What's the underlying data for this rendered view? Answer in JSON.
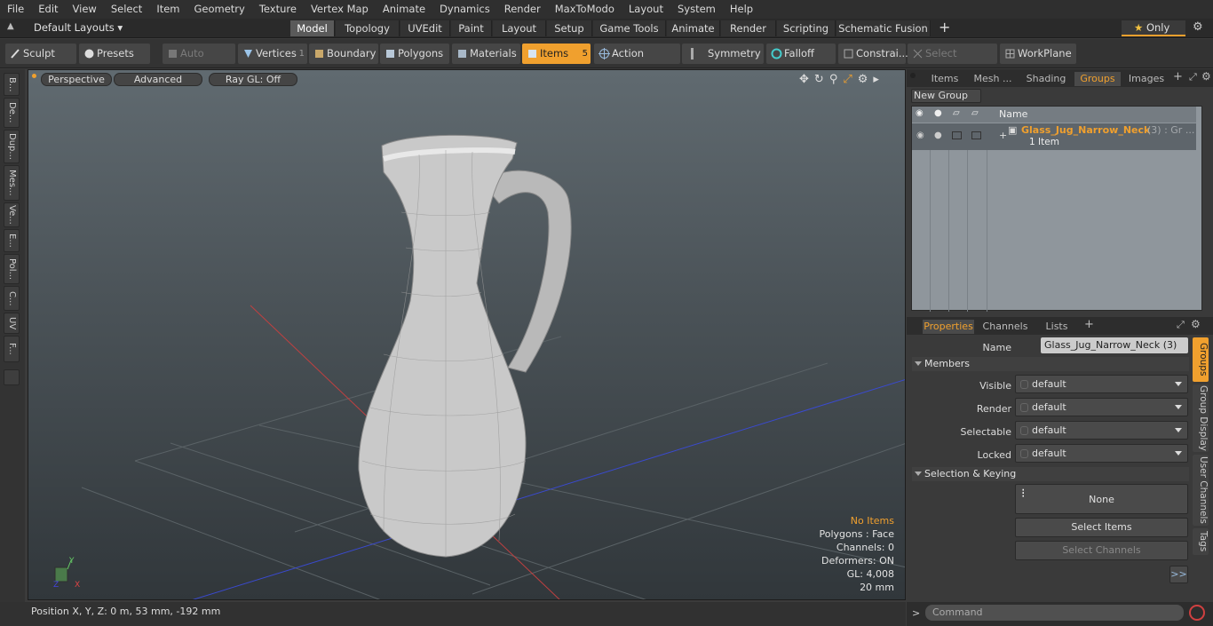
{
  "menu": [
    "File",
    "Edit",
    "View",
    "Select",
    "Item",
    "Geometry",
    "Texture",
    "Vertex Map",
    "Animate",
    "Dynamics",
    "Render",
    "MaxToModo",
    "Layout",
    "System",
    "Help"
  ],
  "layout_selector": "Default Layouts",
  "layout_tabs": [
    "Model",
    "Topology",
    "UVEdit",
    "Paint",
    "Layout",
    "Setup",
    "Game Tools",
    "Animate",
    "Render",
    "Scripting",
    "Schematic Fusion"
  ],
  "only_label": "Only",
  "toolbar": {
    "sculpt": "Sculpt",
    "presets": "Presets",
    "auto_select": "Auto Select",
    "vertices": "Vertices",
    "vertices_count": "1",
    "boundary": "Boundary",
    "polygons": "Polygons",
    "materials": "Materials",
    "items": "Items",
    "items_count": "5",
    "action_center": "Action Center",
    "symmetry": "Symmetry",
    "falloff": "Falloff",
    "constraints": "Constrai...",
    "select_through": "Select Through",
    "workplane": "WorkPlane"
  },
  "left_tabs": [
    "B...",
    "De...",
    "Dup...",
    "Mes...",
    "Ve...",
    "E...",
    "Pol...",
    "C...",
    "UV",
    "F..."
  ],
  "viewport": {
    "perspective": "Perspective",
    "advanced": "Advanced",
    "raygl": "Ray GL: Off"
  },
  "stats": {
    "no_items": "No Items",
    "polygons": "Polygons : Face",
    "channels": "Channels: 0",
    "deformers": "Deformers: ON",
    "gl": "GL: 4,008",
    "scale": "20 mm"
  },
  "status": {
    "position": "Position X, Y, Z:   0 m, 53 mm, -192 mm"
  },
  "right_tabs": [
    "Items",
    "Mesh ...",
    "Shading",
    "Groups",
    "Images"
  ],
  "new_group": "New Group",
  "groups_header": "Name",
  "group": {
    "name": "Glass_Jug_Narrow_Neck",
    "suffix": "(3) : Gr ...",
    "sub": "1 Item"
  },
  "props_tabs": [
    "Properties",
    "Channels",
    "Lists"
  ],
  "props": {
    "name_label": "Name",
    "name_value": "Glass_Jug_Narrow_Neck (3)",
    "members": "Members",
    "visible_label": "Visible",
    "render_label": "Render",
    "selectable_label": "Selectable",
    "locked_label": "Locked",
    "dd_value": "default",
    "sel_keying": "Selection & Keying",
    "none": "None",
    "select_items": "Select Items",
    "select_channels": "Select Channels",
    "more": ">>"
  },
  "side_tabs": [
    "Groups",
    "Group Display",
    "User Channels",
    "Tags"
  ],
  "command_placeholder": "Command",
  "colors": {
    "accent": "#f0a02e",
    "group_name": "#f0a02e"
  }
}
